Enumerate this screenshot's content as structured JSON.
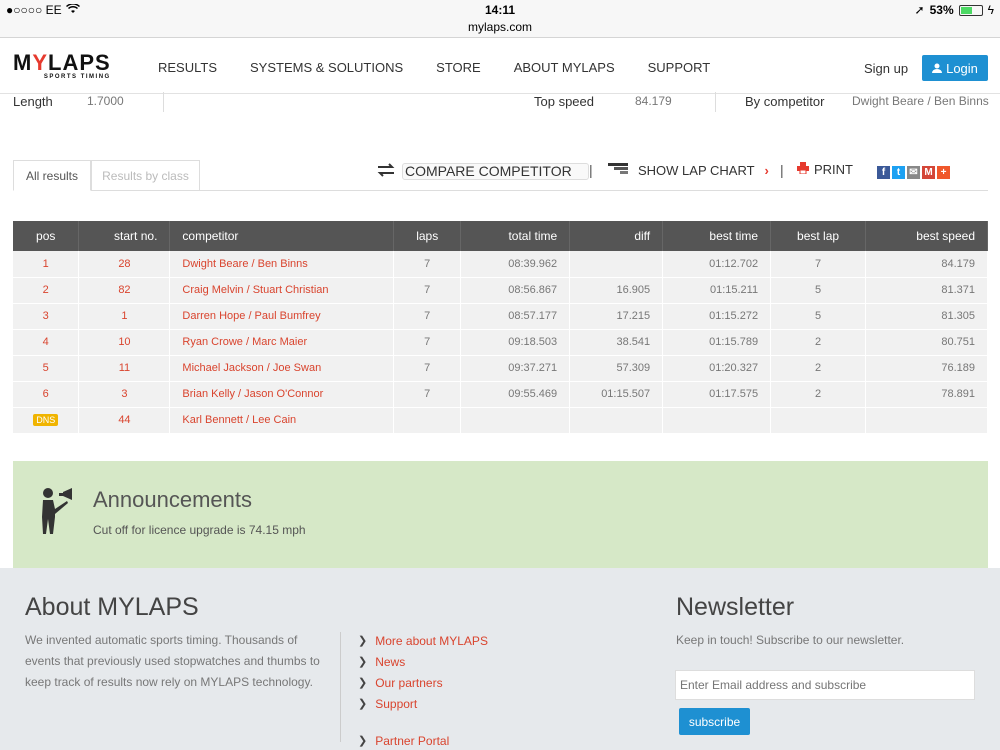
{
  "status": {
    "carrier": "●○○○○ EE",
    "time": "14:11",
    "battery": "53%",
    "battery_level": 0.53
  },
  "url": "mylaps.com",
  "brand": {
    "name_part1": "M",
    "name_y": "Y",
    "name_part2": "LAPS",
    "tagline": "SPORTS TIMING"
  },
  "nav": {
    "items": [
      "RESULTS",
      "SYSTEMS & SOLUTIONS",
      "STORE",
      "ABOUT MYLAPS",
      "SUPPORT"
    ],
    "signup": "Sign up",
    "login": "Login"
  },
  "info": {
    "length_label": "Length",
    "length_value": "1.7000",
    "top_speed_label": "Top speed",
    "top_speed_value": "84.179",
    "by_competitor_label": "By competitor",
    "by_competitor_value": "Dwight Beare / Ben Binns"
  },
  "tabs": {
    "all_results": "All results",
    "results_by_class": "Results by class"
  },
  "tools": {
    "compare": "COMPARE COMPETITOR",
    "lap_chart": "SHOW LAP CHART",
    "print": "PRINT"
  },
  "table": {
    "headers": [
      "pos",
      "start no.",
      "competitor",
      "laps",
      "total time",
      "diff",
      "best time",
      "best lap",
      "best speed"
    ],
    "rows": [
      [
        "1",
        "28",
        "Dwight Beare / Ben Binns",
        "7",
        "08:39.962",
        "",
        "01:12.702",
        "7",
        "84.179"
      ],
      [
        "2",
        "82",
        "Craig Melvin / Stuart Christian",
        "7",
        "08:56.867",
        "16.905",
        "01:15.211",
        "5",
        "81.371"
      ],
      [
        "3",
        "1",
        "Darren Hope / Paul Bumfrey",
        "7",
        "08:57.177",
        "17.215",
        "01:15.272",
        "5",
        "81.305"
      ],
      [
        "4",
        "10",
        "Ryan Crowe / Marc Maier",
        "7",
        "09:18.503",
        "38.541",
        "01:15.789",
        "2",
        "80.751"
      ],
      [
        "5",
        "11",
        "Michael Jackson / Joe Swan",
        "7",
        "09:37.271",
        "57.309",
        "01:20.327",
        "2",
        "76.189"
      ],
      [
        "6",
        "3",
        "Brian Kelly / Jason O'Connor",
        "7",
        "09:55.469",
        "01:15.507",
        "01:17.575",
        "2",
        "78.891"
      ],
      [
        "DNS",
        "44",
        "Karl Bennett / Lee Cain",
        "",
        "",
        "",
        "",
        "",
        ""
      ]
    ]
  },
  "announcements": {
    "title": "Announcements",
    "text": "Cut off for licence upgrade is 74.15 mph"
  },
  "footer": {
    "about_title": "About MYLAPS",
    "about_text": "We invented automatic sports timing. Thousands of events that previously used stopwatches and thumbs to keep track of results now rely on MYLAPS technology.",
    "links": [
      "More about MYLAPS",
      "News",
      "Our partners",
      "Support",
      "Partner Portal"
    ],
    "newsletter_title": "Newsletter",
    "newsletter_text": "Keep in touch! Subscribe to our newsletter.",
    "email_placeholder": "Enter Email address and subscribe",
    "subscribe": "subscribe"
  }
}
